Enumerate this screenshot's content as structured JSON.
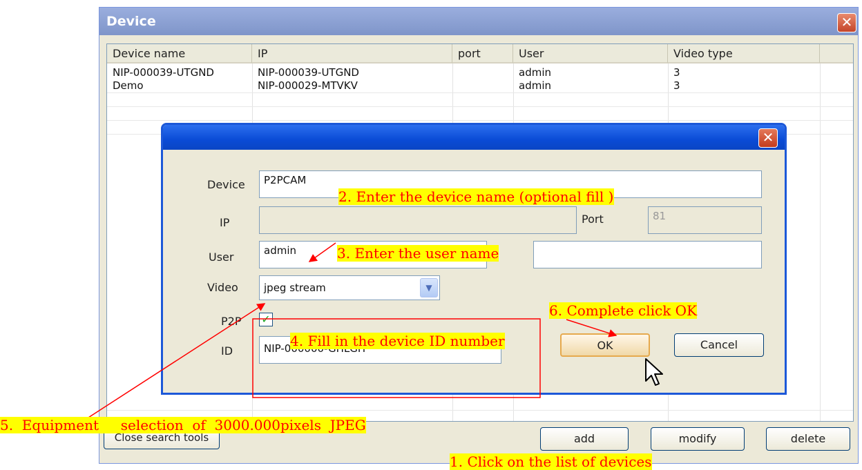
{
  "window": {
    "title": "Device",
    "close_glyph": "✕"
  },
  "columns": [
    "Device name",
    "IP",
    "port",
    "User",
    "Video type"
  ],
  "rows": [
    {
      "name": "NIP-000039-UTGND",
      "ip": "NIP-000039-UTGND",
      "port": "",
      "user": "admin",
      "video_type": "3"
    },
    {
      "name": "Demo",
      "ip": "NIP-000029-MTVKV",
      "port": "",
      "user": "admin",
      "video_type": "3"
    }
  ],
  "dialog": {
    "close_glyph": "✕",
    "device_label": "Device",
    "device_value": "P2PCAM",
    "ip_label": "IP",
    "ip_value": "",
    "port_label": "Port",
    "port_value": "81",
    "user_label": "User",
    "user_value": "admin",
    "password_value": "",
    "video_label": "Video",
    "video_value": "jpeg stream",
    "p2p_label": "P2P",
    "p2p_checked": true,
    "id_label": "ID",
    "id_value": "NIP-000000-GHLGH",
    "ok_label": "OK",
    "cancel_label": "Cancel"
  },
  "bottom_buttons": {
    "close_search": "Close search tools",
    "add": "add",
    "modify": "modify",
    "delete": "delete"
  },
  "annotations": {
    "step1": "1. Click on the list of devices",
    "step2": "2. Enter the device name (optional fill )",
    "step3": "3. Enter the user name",
    "step4": "4. Fill in the device ID number",
    "step5": "5.  Equipment     selection  of  3000.000pixels  JPEG",
    "step6": "6. Complete click OK"
  },
  "colors": {
    "annotation_bg": "#ffff00",
    "annotation_text": "#ff0000",
    "dialog_title": "#0a4bd6"
  }
}
